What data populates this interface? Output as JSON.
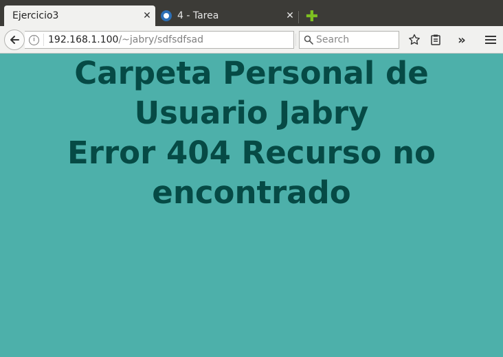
{
  "tabs": [
    {
      "title": "Ejercicio3",
      "active": true,
      "close": "✕"
    },
    {
      "title": "4 - Tarea",
      "active": false,
      "close": "✕"
    }
  ],
  "new_tab_icon": "plus-icon",
  "toolbar": {
    "url_host": "192.168.1.100",
    "url_path": "/~jabry/sdfsdfsad",
    "search_placeholder": "Search",
    "overflow_label": "»"
  },
  "page": {
    "heading_line1": "Carpeta Personal de",
    "heading_line2": "Usuario Jabry",
    "heading_line3": "Error 404 Recurso no",
    "heading_line4": "encontrado"
  },
  "colors": {
    "page_background": "#4db0aa",
    "heading_text": "#064a45",
    "new_tab_plus": "#7dc021"
  }
}
